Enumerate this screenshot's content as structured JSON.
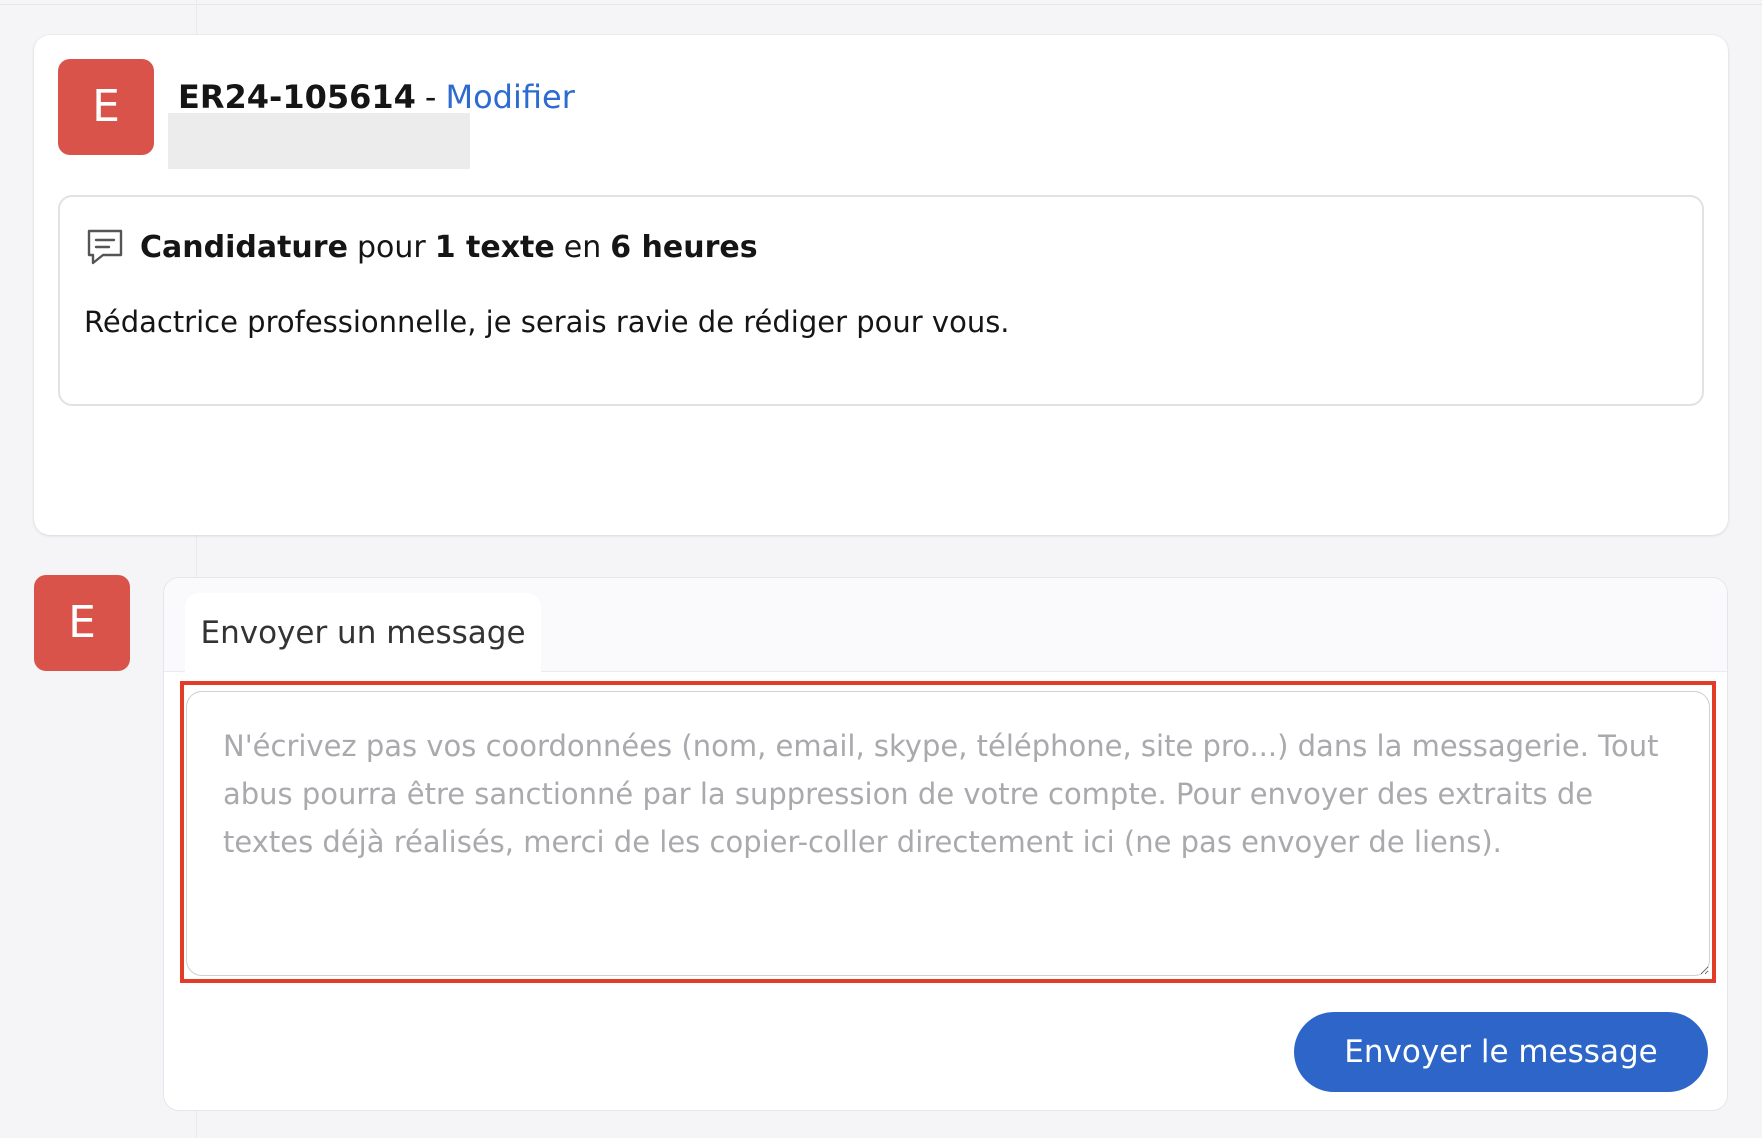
{
  "colors": {
    "avatar_bg": "#d9534a",
    "link": "#2e6bd0",
    "primary_button": "#2d66c8",
    "highlight": "#e23b28"
  },
  "icons": {
    "bid": "speech-bubble-icon"
  },
  "order": {
    "avatar_letter": "E",
    "reference": "ER24-105614",
    "separator": "-",
    "edit_link": "Modifier"
  },
  "bid": {
    "label": "Candidature",
    "word_for": "pour",
    "quantity": "1 texte",
    "word_in": "en",
    "duration": "6 heures",
    "message": "Rédactrice professionnelle, je serais ravie de rédiger pour vous."
  },
  "composer": {
    "avatar_letter": "E",
    "tab_label": "Envoyer un message",
    "placeholder": "N'écrivez pas vos coordonnées (nom, email, skype, téléphone, site pro...) dans la messagerie. Tout abus pourra être sanctionné par la suppression de votre compte. Pour envoyer des extraits de textes déjà réalisés, merci de les copier-coller directement ici (ne pas envoyer de liens).",
    "value": "",
    "send_label": "Envoyer le message"
  }
}
